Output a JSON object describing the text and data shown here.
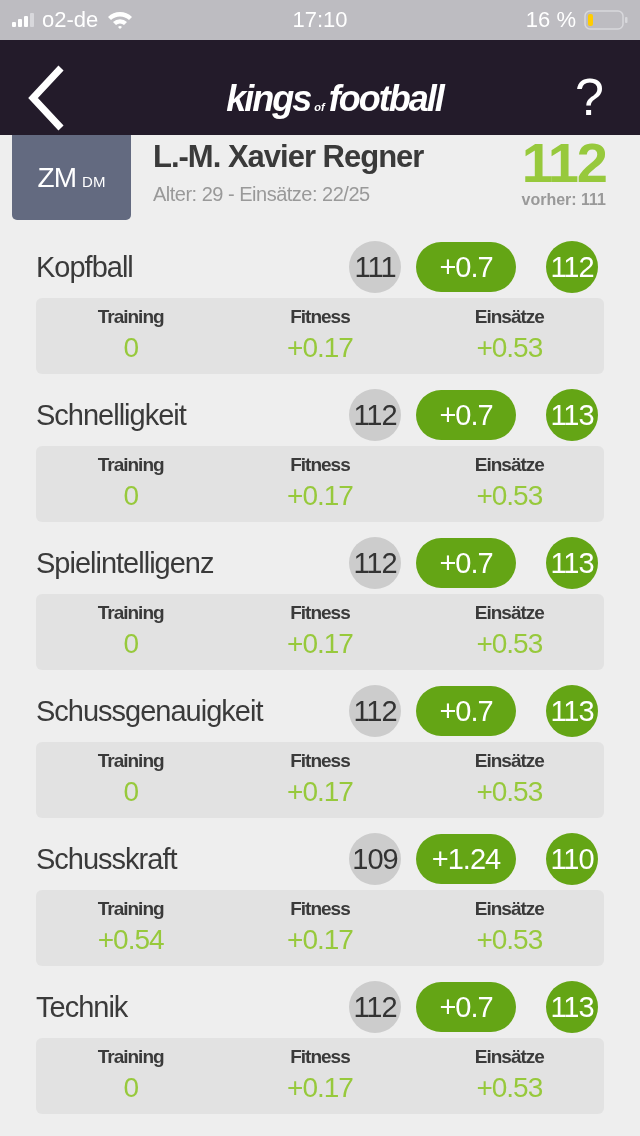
{
  "status_bar": {
    "carrier": "o2-de",
    "time": "17:10",
    "battery": "16 %"
  },
  "header": {
    "logo": {
      "main": "kings",
      "small": "of",
      "end": "football"
    },
    "help": "?"
  },
  "player": {
    "position": "ZM",
    "position_secondary": "DM",
    "name": "L.-M. Xavier Regner",
    "details": "Alter: 29 - Einsätze: 22/25",
    "rating": "112",
    "previous": "vorher: 111"
  },
  "attributes": [
    {
      "name": "Kopfball",
      "old": "111",
      "change": "+0.7",
      "new": "112",
      "breakdown": [
        {
          "label": "Training",
          "value": "0"
        },
        {
          "label": "Fitness",
          "value": "+0.17"
        },
        {
          "label": "Einsätze",
          "value": "+0.53"
        }
      ]
    },
    {
      "name": "Schnelligkeit",
      "old": "112",
      "change": "+0.7",
      "new": "113",
      "breakdown": [
        {
          "label": "Training",
          "value": "0"
        },
        {
          "label": "Fitness",
          "value": "+0.17"
        },
        {
          "label": "Einsätze",
          "value": "+0.53"
        }
      ]
    },
    {
      "name": "Spielintelligenz",
      "old": "112",
      "change": "+0.7",
      "new": "113",
      "breakdown": [
        {
          "label": "Training",
          "value": "0"
        },
        {
          "label": "Fitness",
          "value": "+0.17"
        },
        {
          "label": "Einsätze",
          "value": "+0.53"
        }
      ]
    },
    {
      "name": "Schussgenauigkeit",
      "old": "112",
      "change": "+0.7",
      "new": "113",
      "breakdown": [
        {
          "label": "Training",
          "value": "0"
        },
        {
          "label": "Fitness",
          "value": "+0.17"
        },
        {
          "label": "Einsätze",
          "value": "+0.53"
        }
      ]
    },
    {
      "name": "Schusskraft",
      "old": "109",
      "change": "+1.24",
      "new": "110",
      "breakdown": [
        {
          "label": "Training",
          "value": "+0.54"
        },
        {
          "label": "Fitness",
          "value": "+0.17"
        },
        {
          "label": "Einsätze",
          "value": "+0.53"
        }
      ]
    },
    {
      "name": "Technik",
      "old": "112",
      "change": "+0.7",
      "new": "113",
      "breakdown": [
        {
          "label": "Training",
          "value": "0"
        },
        {
          "label": "Fitness",
          "value": "+0.17"
        },
        {
          "label": "Einsätze",
          "value": "+0.53"
        }
      ]
    }
  ]
}
